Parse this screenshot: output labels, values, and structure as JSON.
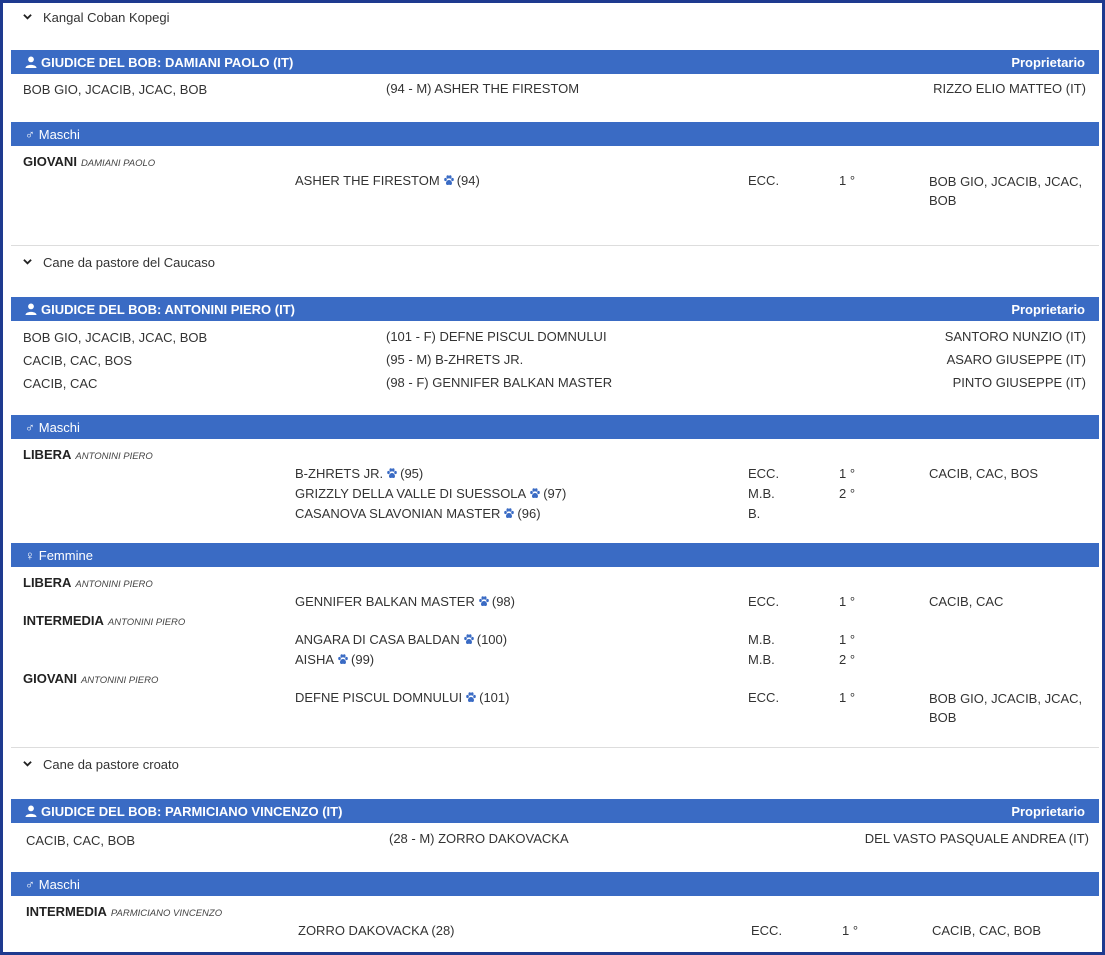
{
  "colors": {
    "bar": "#3a6bc4",
    "frame": "#1e3a8f",
    "paw": "#3a6bc4"
  },
  "breeds": [
    {
      "title": "Kangal Coban Kopegi",
      "judge_bar": "GIUDICE DEL BOB: DAMIANI PAOLO (IT)",
      "owner_header": "Proprietario",
      "bob": [
        {
          "titles": "BOB GIO, JCACIB, JCAC, BOB",
          "dog": "(94 - M) ASHER THE FIRESTOM",
          "owner": "RIZZO ELIO MATTEO (IT)"
        }
      ],
      "groups": [
        {
          "label": "Maschi",
          "classes": [
            {
              "name": "GIOVANI",
              "judge": "DAMIANI PAOLO",
              "entries": [
                {
                  "dog": "ASHER THE FIRESTOM",
                  "num": "(94)",
                  "grade": "ECC.",
                  "place": "1 °",
                  "award": "BOB GIO, JCACIB, JCAC, BOB"
                }
              ]
            }
          ]
        }
      ]
    },
    {
      "title": "Cane da pastore del Caucaso",
      "judge_bar": "GIUDICE DEL BOB: ANTONINI PIERO (IT)",
      "owner_header": "Proprietario",
      "bob": [
        {
          "titles": "BOB GIO, JCACIB, JCAC, BOB",
          "dog": "(101 - F) DEFNE PISCUL DOMNULUI",
          "owner": "SANTORO NUNZIO (IT)"
        },
        {
          "titles": "CACIB, CAC, BOS",
          "dog": "(95 - M) B-ZHRETS JR.",
          "owner": "ASARO GIUSEPPE (IT)"
        },
        {
          "titles": "CACIB, CAC",
          "dog": "(98 - F) GENNIFER BALKAN MASTER",
          "owner": "PINTO GIUSEPPE (IT)"
        }
      ],
      "groups": [
        {
          "label": "Maschi",
          "classes": [
            {
              "name": "LIBERA",
              "judge": "ANTONINI PIERO",
              "entries": [
                {
                  "dog": "B-ZHRETS JR.",
                  "num": "(95)",
                  "grade": "ECC.",
                  "place": "1 °",
                  "award": "CACIB, CAC, BOS"
                },
                {
                  "dog": "GRIZZLY DELLA VALLE DI SUESSOLA",
                  "num": "(97)",
                  "grade": "M.B.",
                  "place": "2 °",
                  "award": ""
                },
                {
                  "dog": "CASANOVA SLAVONIAN MASTER",
                  "num": "(96)",
                  "grade": "B.",
                  "place": "",
                  "award": ""
                }
              ]
            }
          ]
        },
        {
          "label": "Femmine",
          "classes": [
            {
              "name": "LIBERA",
              "judge": "ANTONINI PIERO",
              "entries": [
                {
                  "dog": "GENNIFER BALKAN MASTER",
                  "num": "(98)",
                  "grade": "ECC.",
                  "place": "1 °",
                  "award": "CACIB, CAC"
                }
              ]
            },
            {
              "name": "INTERMEDIA",
              "judge": "ANTONINI PIERO",
              "entries": [
                {
                  "dog": "ANGARA DI CASA BALDAN",
                  "num": "(100)",
                  "grade": "M.B.",
                  "place": "1 °",
                  "award": ""
                },
                {
                  "dog": "AISHA",
                  "num": "(99)",
                  "grade": "M.B.",
                  "place": "2 °",
                  "award": ""
                }
              ]
            },
            {
              "name": "GIOVANI",
              "judge": "ANTONINI PIERO",
              "entries": [
                {
                  "dog": "DEFNE PISCUL DOMNULUI",
                  "num": "(101)",
                  "grade": "ECC.",
                  "place": "1 °",
                  "award": "BOB GIO, JCACIB, JCAC, BOB"
                }
              ]
            }
          ]
        }
      ]
    },
    {
      "title": "Cane da pastore croato",
      "judge_bar": "GIUDICE DEL BOB: PARMICIANO VINCENZO (IT)",
      "owner_header": "Proprietario",
      "bob": [
        {
          "titles": "CACIB, CAC, BOB",
          "dog": "(28 - M) ZORRO DAKOVACKA",
          "owner": "DEL VASTO PASQUALE ANDREA (IT)"
        }
      ],
      "groups": [
        {
          "label": "Maschi",
          "classes": [
            {
              "name": "INTERMEDIA",
              "judge": "PARMICIANO VINCENZO",
              "entries": [
                {
                  "dog": "ZORRO DAKOVACKA (28)",
                  "num": "",
                  "grade": "ECC.",
                  "place": "1 °",
                  "award": "CACIB, CAC, BOB"
                }
              ]
            }
          ]
        }
      ]
    }
  ]
}
